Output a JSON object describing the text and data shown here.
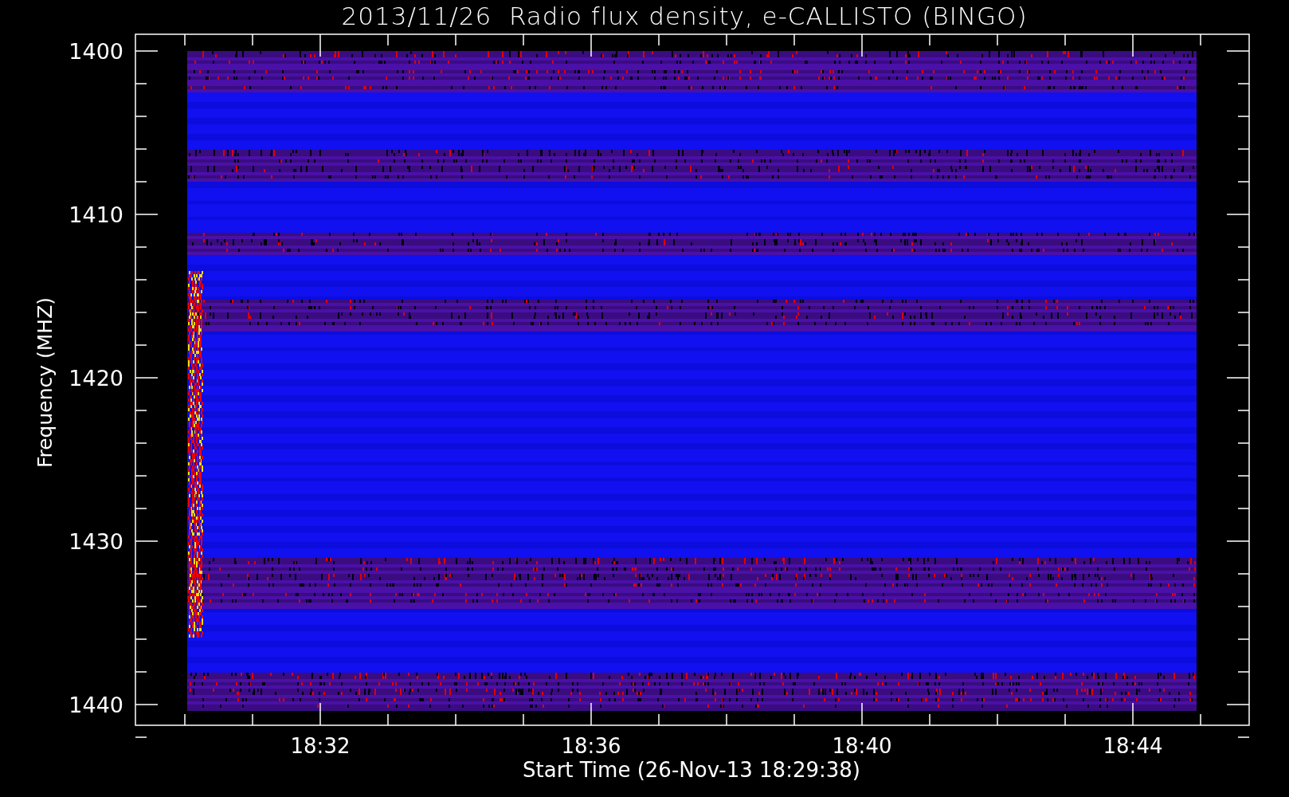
{
  "title": "2013/11/26  Radio flux density, e-CALLISTO (BINGO)",
  "y_axis": {
    "label": "Frequency (MHZ)",
    "ticks": [
      "1400",
      "1410",
      "1420",
      "1430",
      "1440"
    ]
  },
  "x_axis": {
    "label": "Start Time (26-Nov-13 18:29:38)",
    "ticks": [
      "18:32",
      "18:36",
      "18:40",
      "18:44"
    ]
  }
}
